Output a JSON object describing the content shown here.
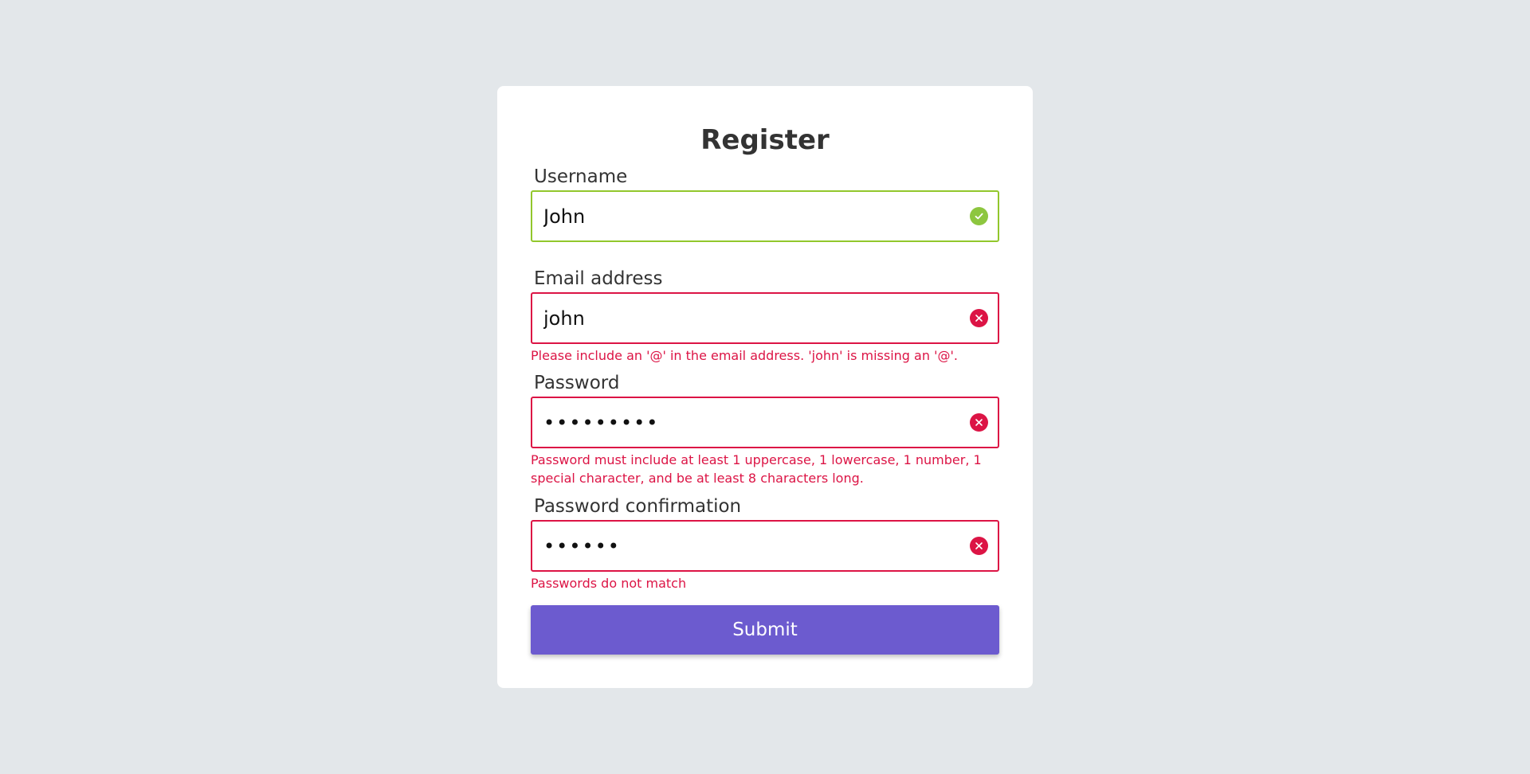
{
  "form": {
    "title": "Register",
    "colors": {
      "background": "#e3e7ea",
      "card": "#ffffff",
      "valid": "#92c72c",
      "error": "#dc1445",
      "submit": "#6c5bcf"
    },
    "username": {
      "label": "Username",
      "value": "John",
      "status": "valid",
      "status_icon": "check-circle-icon"
    },
    "email": {
      "label": "Email address",
      "value": "john",
      "status": "error",
      "status_icon": "x-circle-icon",
      "error": "Please include an '@' in the email address. 'john' is missing an '@'."
    },
    "password": {
      "label": "Password",
      "value": "•••••••••",
      "status": "error",
      "status_icon": "x-circle-icon",
      "error": "Password must include at least 1 uppercase, 1 lowercase, 1 number, 1 special character, and be at least 8 characters long."
    },
    "password_confirmation": {
      "label": "Password confirmation",
      "value": "••••••",
      "status": "error",
      "status_icon": "x-circle-icon",
      "error": "Passwords do not match"
    },
    "submit_label": "Submit"
  }
}
